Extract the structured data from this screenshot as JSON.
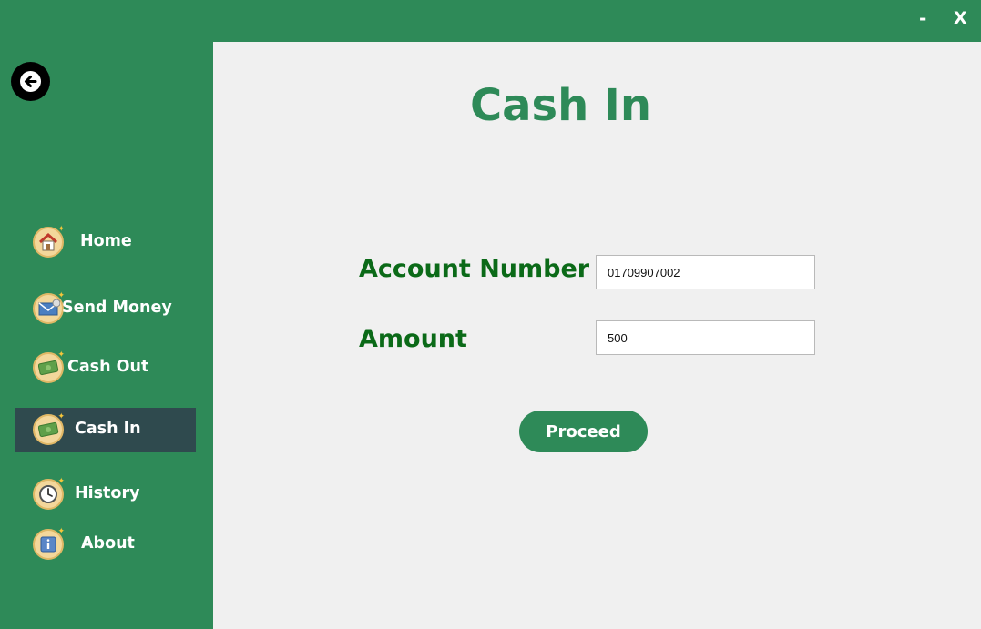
{
  "window": {
    "minimize_label": "-",
    "close_label": "X"
  },
  "sidebar": {
    "items": [
      {
        "label": "Home",
        "icon": "home-icon"
      },
      {
        "label": "Send Money",
        "icon": "envelope-icon"
      },
      {
        "label": "Cash Out",
        "icon": "money-icon"
      },
      {
        "label": "Cash In",
        "icon": "money-icon",
        "active": true
      },
      {
        "label": "History",
        "icon": "clock-icon"
      },
      {
        "label": "About",
        "icon": "info-icon"
      }
    ]
  },
  "main": {
    "title": "Cash In",
    "account_label": "Account Number",
    "account_value": "01709907002",
    "amount_label": "Amount",
    "amount_value": "500",
    "proceed_label": "Proceed"
  },
  "colors": {
    "sidebar_bg": "#2e8a58",
    "active_item_bg": "#2f4a4e",
    "content_bg": "#f0f0f0",
    "title_color": "#2e8a58",
    "label_color": "#0b6a18"
  }
}
